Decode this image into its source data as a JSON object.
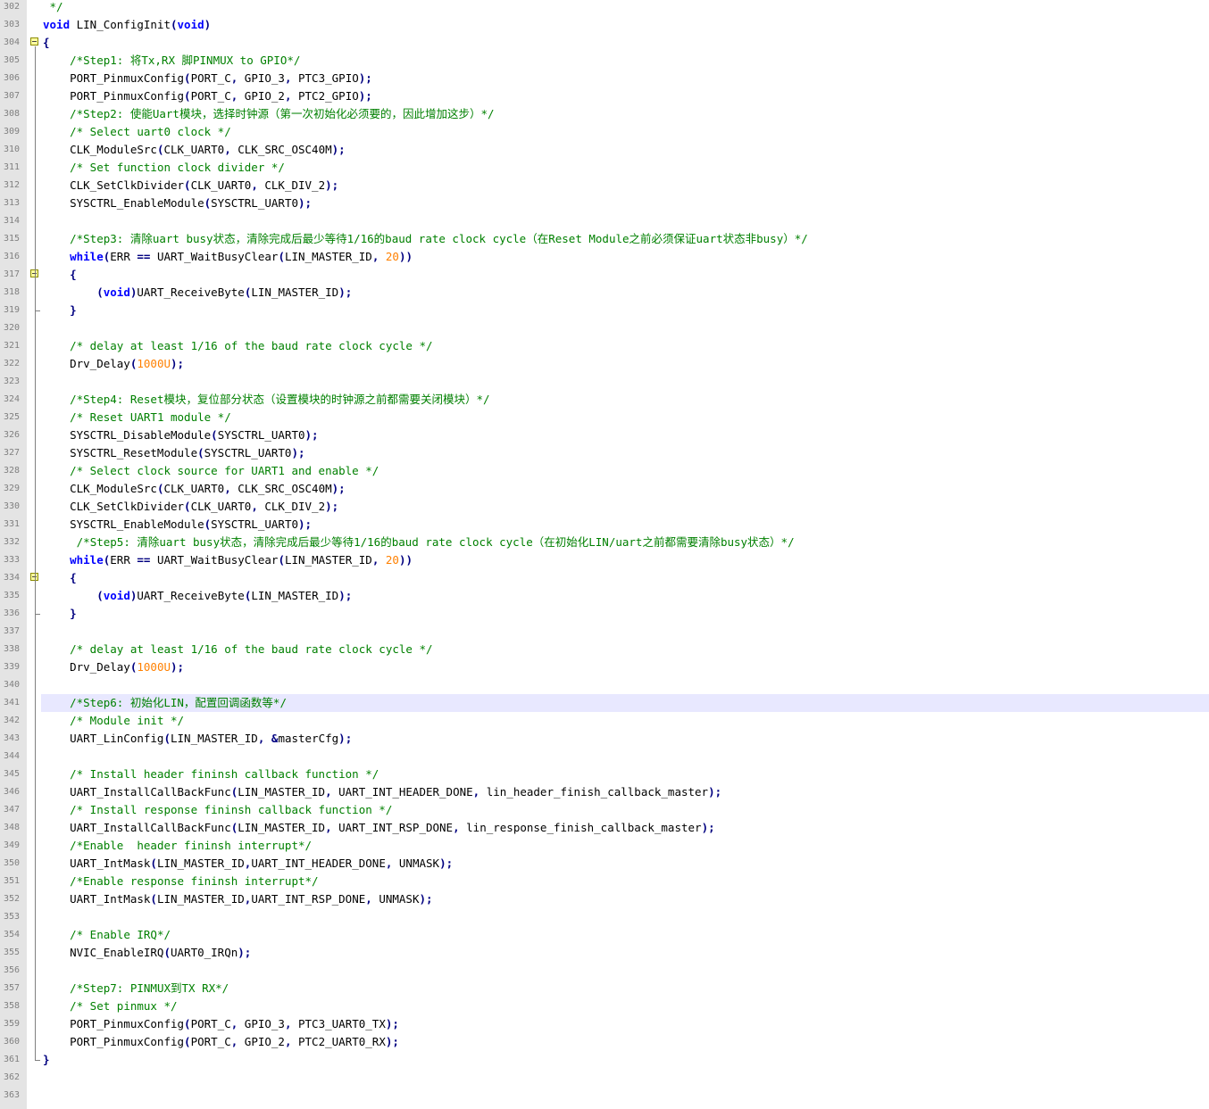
{
  "editor": {
    "colors": {
      "keyword": "#0000ff",
      "comment": "#008000",
      "number": "#ff8000",
      "operator": "#000080",
      "text": "#000000",
      "line_number": "#808080",
      "current_line": "#e8e8ff",
      "gutter": "#e4e4e4"
    },
    "current_line": 341,
    "fold_markers": [
      304,
      317,
      334
    ],
    "fold_ends": [
      319,
      336,
      361
    ],
    "lines": [
      {
        "n": "302",
        "t": [
          [
            "comment",
            " */"
          ]
        ]
      },
      {
        "n": "303",
        "t": [
          [
            "kw",
            "void"
          ],
          [
            "plain",
            " LIN_ConfigInit"
          ],
          [
            "op",
            "("
          ],
          [
            "kw",
            "void"
          ],
          [
            "op",
            ")"
          ]
        ]
      },
      {
        "n": "304",
        "t": [
          [
            "op",
            "{"
          ]
        ]
      },
      {
        "n": "305",
        "t": [
          [
            "plain",
            "    "
          ],
          [
            "comment",
            "/*Step1: 将Tx,RX 脚PINMUX to GPIO*/"
          ]
        ]
      },
      {
        "n": "306",
        "t": [
          [
            "plain",
            "    PORT_PinmuxConfig"
          ],
          [
            "op",
            "("
          ],
          [
            "plain",
            "PORT_C"
          ],
          [
            "op",
            ","
          ],
          [
            "plain",
            " GPIO_3"
          ],
          [
            "op",
            ","
          ],
          [
            "plain",
            " PTC3_GPIO"
          ],
          [
            "op",
            ");"
          ]
        ]
      },
      {
        "n": "307",
        "t": [
          [
            "plain",
            "    PORT_PinmuxConfig"
          ],
          [
            "op",
            "("
          ],
          [
            "plain",
            "PORT_C"
          ],
          [
            "op",
            ","
          ],
          [
            "plain",
            " GPIO_2"
          ],
          [
            "op",
            ","
          ],
          [
            "plain",
            " PTC2_GPIO"
          ],
          [
            "op",
            ");"
          ]
        ]
      },
      {
        "n": "308",
        "t": [
          [
            "plain",
            "    "
          ],
          [
            "comment",
            "/*Step2: 使能Uart模块，选择时钟源（第一次初始化必须要的，因此增加这步）*/"
          ]
        ]
      },
      {
        "n": "309",
        "t": [
          [
            "plain",
            "    "
          ],
          [
            "comment",
            "/* Select uart0 clock */"
          ]
        ]
      },
      {
        "n": "310",
        "t": [
          [
            "plain",
            "    CLK_ModuleSrc"
          ],
          [
            "op",
            "("
          ],
          [
            "plain",
            "CLK_UART0"
          ],
          [
            "op",
            ","
          ],
          [
            "plain",
            " CLK_SRC_OSC40M"
          ],
          [
            "op",
            ");"
          ]
        ]
      },
      {
        "n": "311",
        "t": [
          [
            "plain",
            "    "
          ],
          [
            "comment",
            "/* Set function clock divider */"
          ]
        ]
      },
      {
        "n": "312",
        "t": [
          [
            "plain",
            "    CLK_SetClkDivider"
          ],
          [
            "op",
            "("
          ],
          [
            "plain",
            "CLK_UART0"
          ],
          [
            "op",
            ","
          ],
          [
            "plain",
            " CLK_DIV_2"
          ],
          [
            "op",
            ");"
          ]
        ]
      },
      {
        "n": "313",
        "t": [
          [
            "plain",
            "    SYSCTRL_EnableModule"
          ],
          [
            "op",
            "("
          ],
          [
            "plain",
            "SYSCTRL_UART0"
          ],
          [
            "op",
            ");"
          ]
        ]
      },
      {
        "n": "314",
        "t": []
      },
      {
        "n": "315",
        "t": [
          [
            "plain",
            "    "
          ],
          [
            "comment",
            "/*Step3: 清除uart busy状态，清除完成后最少等待1/16的baud rate clock cycle（在Reset Module之前必须保证uart状态非busy）*/"
          ]
        ]
      },
      {
        "n": "316",
        "t": [
          [
            "plain",
            "    "
          ],
          [
            "kw",
            "while"
          ],
          [
            "op",
            "("
          ],
          [
            "plain",
            "ERR "
          ],
          [
            "op",
            "=="
          ],
          [
            "plain",
            " UART_WaitBusyClear"
          ],
          [
            "op",
            "("
          ],
          [
            "plain",
            "LIN_MASTER_ID"
          ],
          [
            "op",
            ","
          ],
          [
            "plain",
            " "
          ],
          [
            "number",
            "20"
          ],
          [
            "op",
            "))"
          ]
        ]
      },
      {
        "n": "317",
        "t": [
          [
            "plain",
            "    "
          ],
          [
            "op",
            "{"
          ]
        ]
      },
      {
        "n": "318",
        "t": [
          [
            "plain",
            "        "
          ],
          [
            "op",
            "("
          ],
          [
            "kw",
            "void"
          ],
          [
            "op",
            ")"
          ],
          [
            "plain",
            "UART_ReceiveByte"
          ],
          [
            "op",
            "("
          ],
          [
            "plain",
            "LIN_MASTER_ID"
          ],
          [
            "op",
            ");"
          ]
        ]
      },
      {
        "n": "319",
        "t": [
          [
            "plain",
            "    "
          ],
          [
            "op",
            "}"
          ]
        ]
      },
      {
        "n": "320",
        "t": []
      },
      {
        "n": "321",
        "t": [
          [
            "plain",
            "    "
          ],
          [
            "comment",
            "/* delay at least 1/16 of the baud rate clock cycle */"
          ]
        ]
      },
      {
        "n": "322",
        "t": [
          [
            "plain",
            "    Drv_Delay"
          ],
          [
            "op",
            "("
          ],
          [
            "number",
            "1000U"
          ],
          [
            "op",
            ");"
          ]
        ]
      },
      {
        "n": "323",
        "t": []
      },
      {
        "n": "324",
        "t": [
          [
            "plain",
            "    "
          ],
          [
            "comment",
            "/*Step4: Reset模块，复位部分状态（设置模块的时钟源之前都需要关闭模块）*/"
          ]
        ]
      },
      {
        "n": "325",
        "t": [
          [
            "plain",
            "    "
          ],
          [
            "comment",
            "/* Reset UART1 module */"
          ]
        ]
      },
      {
        "n": "326",
        "t": [
          [
            "plain",
            "    SYSCTRL_DisableModule"
          ],
          [
            "op",
            "("
          ],
          [
            "plain",
            "SYSCTRL_UART0"
          ],
          [
            "op",
            ");"
          ]
        ]
      },
      {
        "n": "327",
        "t": [
          [
            "plain",
            "    SYSCTRL_ResetModule"
          ],
          [
            "op",
            "("
          ],
          [
            "plain",
            "SYSCTRL_UART0"
          ],
          [
            "op",
            ");"
          ]
        ]
      },
      {
        "n": "328",
        "t": [
          [
            "plain",
            "    "
          ],
          [
            "comment",
            "/* Select clock source for UART1 and enable */"
          ]
        ]
      },
      {
        "n": "329",
        "t": [
          [
            "plain",
            "    CLK_ModuleSrc"
          ],
          [
            "op",
            "("
          ],
          [
            "plain",
            "CLK_UART0"
          ],
          [
            "op",
            ","
          ],
          [
            "plain",
            " CLK_SRC_OSC40M"
          ],
          [
            "op",
            ");"
          ]
        ]
      },
      {
        "n": "330",
        "t": [
          [
            "plain",
            "    CLK_SetClkDivider"
          ],
          [
            "op",
            "("
          ],
          [
            "plain",
            "CLK_UART0"
          ],
          [
            "op",
            ","
          ],
          [
            "plain",
            " CLK_DIV_2"
          ],
          [
            "op",
            ");"
          ]
        ]
      },
      {
        "n": "331",
        "t": [
          [
            "plain",
            "    SYSCTRL_EnableModule"
          ],
          [
            "op",
            "("
          ],
          [
            "plain",
            "SYSCTRL_UART0"
          ],
          [
            "op",
            ");"
          ]
        ]
      },
      {
        "n": "332",
        "t": [
          [
            "plain",
            "     "
          ],
          [
            "comment",
            "/*Step5: 清除uart busy状态，清除完成后最少等待1/16的baud rate clock cycle（在初始化LIN/uart之前都需要清除busy状态）*/"
          ]
        ]
      },
      {
        "n": "333",
        "t": [
          [
            "plain",
            "    "
          ],
          [
            "kw",
            "while"
          ],
          [
            "op",
            "("
          ],
          [
            "plain",
            "ERR "
          ],
          [
            "op",
            "=="
          ],
          [
            "plain",
            " UART_WaitBusyClear"
          ],
          [
            "op",
            "("
          ],
          [
            "plain",
            "LIN_MASTER_ID"
          ],
          [
            "op",
            ","
          ],
          [
            "plain",
            " "
          ],
          [
            "number",
            "20"
          ],
          [
            "op",
            "))"
          ]
        ]
      },
      {
        "n": "334",
        "t": [
          [
            "plain",
            "    "
          ],
          [
            "op",
            "{"
          ]
        ]
      },
      {
        "n": "335",
        "t": [
          [
            "plain",
            "        "
          ],
          [
            "op",
            "("
          ],
          [
            "kw",
            "void"
          ],
          [
            "op",
            ")"
          ],
          [
            "plain",
            "UART_ReceiveByte"
          ],
          [
            "op",
            "("
          ],
          [
            "plain",
            "LIN_MASTER_ID"
          ],
          [
            "op",
            ");"
          ]
        ]
      },
      {
        "n": "336",
        "t": [
          [
            "plain",
            "    "
          ],
          [
            "op",
            "}"
          ]
        ]
      },
      {
        "n": "337",
        "t": []
      },
      {
        "n": "338",
        "t": [
          [
            "plain",
            "    "
          ],
          [
            "comment",
            "/* delay at least 1/16 of the baud rate clock cycle */"
          ]
        ]
      },
      {
        "n": "339",
        "t": [
          [
            "plain",
            "    Drv_Delay"
          ],
          [
            "op",
            "("
          ],
          [
            "number",
            "1000U"
          ],
          [
            "op",
            ");"
          ]
        ]
      },
      {
        "n": "340",
        "t": []
      },
      {
        "n": "341",
        "t": [
          [
            "plain",
            "    "
          ],
          [
            "comment",
            "/*Step6: 初始化LIN，配置回调函数等*/"
          ]
        ]
      },
      {
        "n": "342",
        "t": [
          [
            "plain",
            "    "
          ],
          [
            "comment",
            "/* Module init */"
          ]
        ]
      },
      {
        "n": "343",
        "t": [
          [
            "plain",
            "    UART_LinConfig"
          ],
          [
            "op",
            "("
          ],
          [
            "plain",
            "LIN_MASTER_ID"
          ],
          [
            "op",
            ","
          ],
          [
            "plain",
            " "
          ],
          [
            "op",
            "&"
          ],
          [
            "plain",
            "masterCfg"
          ],
          [
            "op",
            ");"
          ]
        ]
      },
      {
        "n": "344",
        "t": []
      },
      {
        "n": "345",
        "t": [
          [
            "plain",
            "    "
          ],
          [
            "comment",
            "/* Install header fininsh callback function */"
          ]
        ]
      },
      {
        "n": "346",
        "t": [
          [
            "plain",
            "    UART_InstallCallBackFunc"
          ],
          [
            "op",
            "("
          ],
          [
            "plain",
            "LIN_MASTER_ID"
          ],
          [
            "op",
            ","
          ],
          [
            "plain",
            " UART_INT_HEADER_DONE"
          ],
          [
            "op",
            ","
          ],
          [
            "plain",
            " lin_header_finish_callback_master"
          ],
          [
            "op",
            ");"
          ]
        ]
      },
      {
        "n": "347",
        "t": [
          [
            "plain",
            "    "
          ],
          [
            "comment",
            "/* Install response fininsh callback function */"
          ]
        ]
      },
      {
        "n": "348",
        "t": [
          [
            "plain",
            "    UART_InstallCallBackFunc"
          ],
          [
            "op",
            "("
          ],
          [
            "plain",
            "LIN_MASTER_ID"
          ],
          [
            "op",
            ","
          ],
          [
            "plain",
            " UART_INT_RSP_DONE"
          ],
          [
            "op",
            ","
          ],
          [
            "plain",
            " lin_response_finish_callback_master"
          ],
          [
            "op",
            ");"
          ]
        ]
      },
      {
        "n": "349",
        "t": [
          [
            "plain",
            "    "
          ],
          [
            "comment",
            "/*Enable  header fininsh interrupt*/"
          ]
        ]
      },
      {
        "n": "350",
        "t": [
          [
            "plain",
            "    UART_IntMask"
          ],
          [
            "op",
            "("
          ],
          [
            "plain",
            "LIN_MASTER_ID"
          ],
          [
            "op",
            ","
          ],
          [
            "plain",
            "UART_INT_HEADER_DONE"
          ],
          [
            "op",
            ","
          ],
          [
            "plain",
            " UNMASK"
          ],
          [
            "op",
            ");"
          ]
        ]
      },
      {
        "n": "351",
        "t": [
          [
            "plain",
            "    "
          ],
          [
            "comment",
            "/*Enable response fininsh interrupt*/"
          ]
        ]
      },
      {
        "n": "352",
        "t": [
          [
            "plain",
            "    UART_IntMask"
          ],
          [
            "op",
            "("
          ],
          [
            "plain",
            "LIN_MASTER_ID"
          ],
          [
            "op",
            ","
          ],
          [
            "plain",
            "UART_INT_RSP_DONE"
          ],
          [
            "op",
            ","
          ],
          [
            "plain",
            " UNMASK"
          ],
          [
            "op",
            ");"
          ]
        ]
      },
      {
        "n": "353",
        "t": []
      },
      {
        "n": "354",
        "t": [
          [
            "plain",
            "    "
          ],
          [
            "comment",
            "/* Enable IRQ*/"
          ]
        ]
      },
      {
        "n": "355",
        "t": [
          [
            "plain",
            "    NVIC_EnableIRQ"
          ],
          [
            "op",
            "("
          ],
          [
            "plain",
            "UART0_IRQn"
          ],
          [
            "op",
            ");"
          ]
        ]
      },
      {
        "n": "356",
        "t": []
      },
      {
        "n": "357",
        "t": [
          [
            "plain",
            "    "
          ],
          [
            "comment",
            "/*Step7: PINMUX到TX RX*/"
          ]
        ]
      },
      {
        "n": "358",
        "t": [
          [
            "plain",
            "    "
          ],
          [
            "comment",
            "/* Set pinmux */"
          ]
        ]
      },
      {
        "n": "359",
        "t": [
          [
            "plain",
            "    PORT_PinmuxConfig"
          ],
          [
            "op",
            "("
          ],
          [
            "plain",
            "PORT_C"
          ],
          [
            "op",
            ","
          ],
          [
            "plain",
            " GPIO_3"
          ],
          [
            "op",
            ","
          ],
          [
            "plain",
            " PTC3_UART0_TX"
          ],
          [
            "op",
            ");"
          ]
        ]
      },
      {
        "n": "360",
        "t": [
          [
            "plain",
            "    PORT_PinmuxConfig"
          ],
          [
            "op",
            "("
          ],
          [
            "plain",
            "PORT_C"
          ],
          [
            "op",
            ","
          ],
          [
            "plain",
            " GPIO_2"
          ],
          [
            "op",
            ","
          ],
          [
            "plain",
            " PTC2_UART0_RX"
          ],
          [
            "op",
            ");"
          ]
        ]
      },
      {
        "n": "361",
        "t": [
          [
            "op",
            "}"
          ]
        ]
      },
      {
        "n": "362",
        "t": []
      },
      {
        "n": "363",
        "t": []
      }
    ]
  }
}
